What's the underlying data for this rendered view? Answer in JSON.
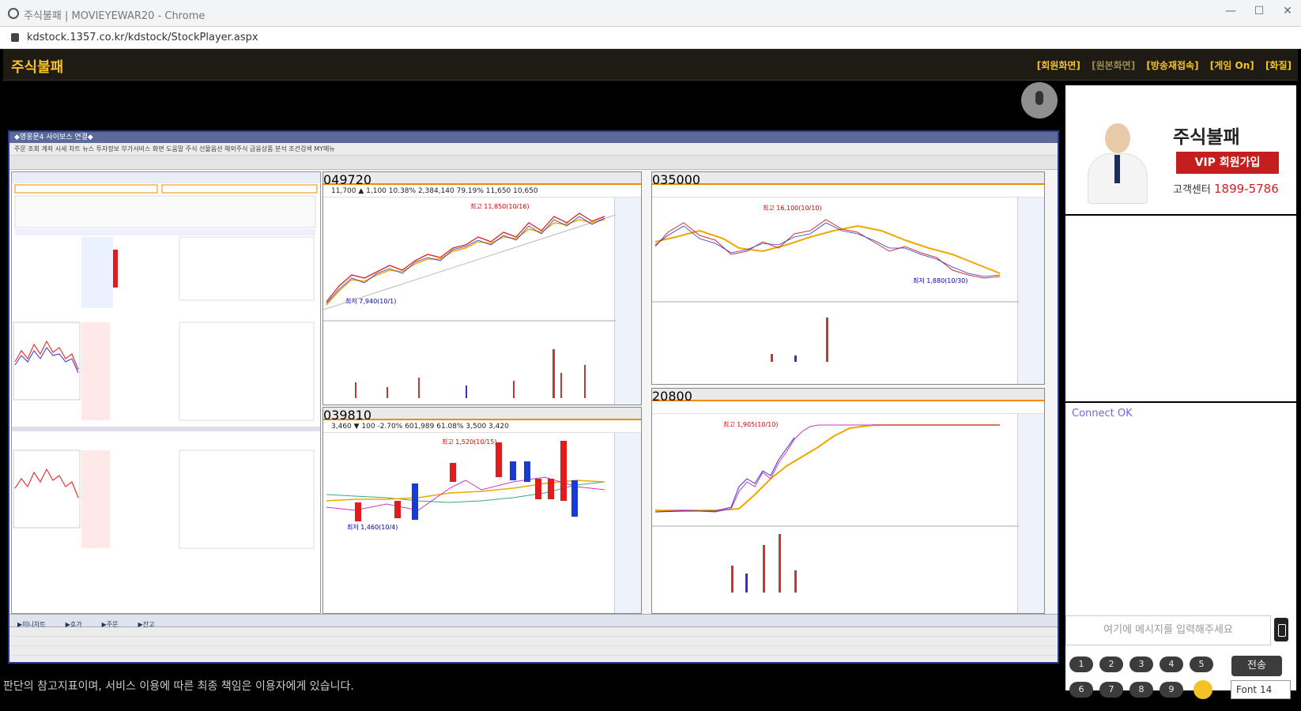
{
  "browser": {
    "window_title": "주식불패 | MOVIEYEWAR20 - Chrome",
    "url": "kdstock.1357.co.kr/kdstock/StockPlayer.aspx",
    "controls": [
      "—",
      "☐",
      "✕"
    ]
  },
  "header": {
    "logo": "주식불패",
    "links": [
      "[회원화면]",
      "[원본화면]",
      "[방송재접속]",
      "[게임 On]",
      "[화질]"
    ]
  },
  "hts": {
    "title": "◆영웅문4 사이보스 연결◆",
    "menu": "주문 조회 계좌 시세 차트 뉴스 투자정보 부가서비스 화면 도움말 주식 선물옵션 해외주식 금융상품 분석 조건검색 MY메뉴",
    "tabs": [
      "▶미니차트",
      "▶호가",
      "▶주문",
      "▶잔고"
    ],
    "charts": [
      {
        "code": "049720",
        "quote": "11,700 ▲ 1,100 10.38% 2,384,140 79.19% 11,650 10,650"
      },
      {
        "code": "039810",
        "quote": "3,460 ▼ 100 -2.70% 601,989 61.08% 3,500 3,420"
      },
      {
        "code": "035000",
        "quote": ""
      },
      {
        "code": "20800",
        "quote": ""
      }
    ],
    "annotations": {
      "a1": "최고 11,850(10/16)",
      "a2": "최저 7,940(10/1)",
      "a3": "최고 16,100(10/10)",
      "a4": "최저 1,880(10/30)",
      "a5": "최고 1,520(10/15)",
      "a6": "최고 1,905(10/10)",
      "a7": "최저 1,460(10/4)"
    }
  },
  "disclaimer": "판단의 참고지표이며, 서비스 이용에 따른 최종 책임은 이용자에게 있습니다.",
  "sidebar": {
    "brand": "주식불패",
    "vip_button": "VIP 회원가입",
    "cs_label": "고객센터",
    "cs_number": "1899-5786"
  },
  "chat": {
    "message": "Connect OK",
    "placeholder": "여기에 메시지를 입력해주세요",
    "keys": [
      "1",
      "2",
      "3",
      "4",
      "5",
      "6",
      "7",
      "8",
      "9"
    ],
    "send_label": "전송",
    "font_label": "Font 14"
  },
  "colors": {
    "brand_gold": "#f5c422",
    "vip_red": "#c41e1e",
    "chat_text": "#6b6be8"
  }
}
